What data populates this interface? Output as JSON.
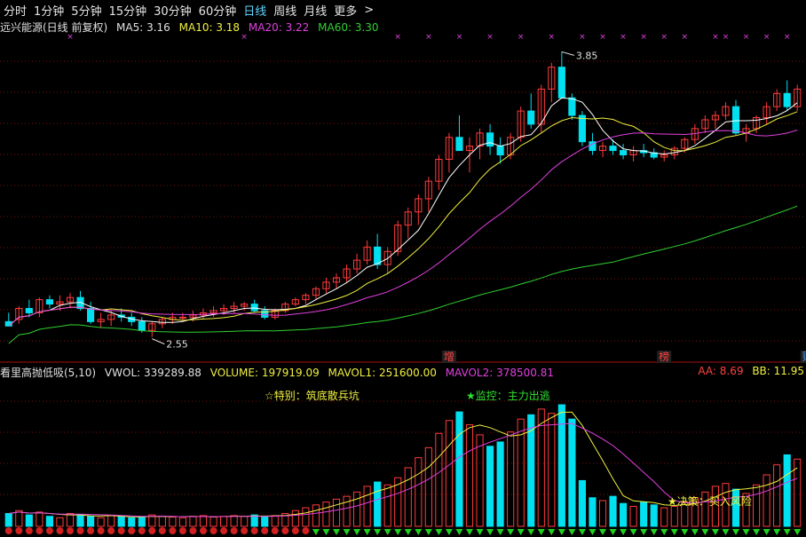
{
  "tabs": [
    {
      "label": "分时",
      "active": false
    },
    {
      "label": "1分钟",
      "active": false
    },
    {
      "label": "5分钟",
      "active": false
    },
    {
      "label": "15分钟",
      "active": false
    },
    {
      "label": "30分钟",
      "active": false
    },
    {
      "label": "60分钟",
      "active": false
    },
    {
      "label": "日线",
      "active": true
    },
    {
      "label": "周线",
      "active": false
    },
    {
      "label": "月线",
      "active": false
    },
    {
      "label": "更多",
      "active": false
    }
  ],
  "more_chevron": ">",
  "price_panel": {
    "title": "远兴能源(日线 前复权)",
    "ma5": "MA5: 3.16",
    "ma10": "MA10: 3.18",
    "ma20": "MA20: 3.22",
    "ma60": "MA60: 3.30",
    "high_label": "3.85",
    "low_label": "2.55",
    "event_tags": [
      "增",
      "榜",
      "财"
    ]
  },
  "volume_panel": {
    "title": "看里高抛低吸(5,10)",
    "vwol": "VWOL: 339289.88",
    "volume": "VOLUME: 197919.09",
    "mavol1": "MAVOL1: 251600.00",
    "mavol2": "MAVOL2: 378500.81",
    "aa": "AA: 8.69",
    "bb": "BB: 11.95",
    "note_special": "☆特别：筑底散兵坑",
    "note_monitor": "★监控：主力出逃",
    "note_decision": "★决策：买入风险"
  },
  "colors": {
    "up": "#ff3b3b",
    "down": "#00e0f0",
    "ma5": "#ffffff",
    "ma10": "#f0f040",
    "ma20": "#e040e0",
    "ma60": "#30d030",
    "grid": "#7a1010",
    "text_ma5": "#e0e0e0",
    "text_ma10": "#f0f040",
    "text_ma20": "#e040e0",
    "text_ma60": "#30d030",
    "annot": "#f0f040",
    "monitor": "#30e030",
    "aa": "#ff4040",
    "bb": "#f0f040",
    "volume": "#f0f040",
    "vwol": "#e0e0e0",
    "mavol1": "#f0f040",
    "mavol2": "#e040e0"
  },
  "chart_data": {
    "type": "candlestick",
    "price_range": [
      2.5,
      3.9
    ],
    "candles": [
      [
        2.62,
        2.66,
        2.6,
        2.6
      ],
      [
        2.63,
        2.69,
        2.61,
        2.68
      ],
      [
        2.68,
        2.72,
        2.64,
        2.66
      ],
      [
        2.66,
        2.73,
        2.64,
        2.72
      ],
      [
        2.72,
        2.74,
        2.68,
        2.7
      ],
      [
        2.7,
        2.74,
        2.67,
        2.71
      ],
      [
        2.71,
        2.75,
        2.68,
        2.73
      ],
      [
        2.73,
        2.76,
        2.67,
        2.68
      ],
      [
        2.68,
        2.71,
        2.61,
        2.62
      ],
      [
        2.62,
        2.66,
        2.59,
        2.63
      ],
      [
        2.63,
        2.67,
        2.6,
        2.65
      ],
      [
        2.65,
        2.68,
        2.62,
        2.64
      ],
      [
        2.64,
        2.66,
        2.6,
        2.62
      ],
      [
        2.62,
        2.64,
        2.57,
        2.58
      ],
      [
        2.58,
        2.62,
        2.55,
        2.61
      ],
      [
        2.61,
        2.64,
        2.59,
        2.63
      ],
      [
        2.63,
        2.66,
        2.61,
        2.64
      ],
      [
        2.64,
        2.66,
        2.62,
        2.64
      ],
      [
        2.64,
        2.67,
        2.62,
        2.65
      ],
      [
        2.65,
        2.68,
        2.63,
        2.66
      ],
      [
        2.66,
        2.69,
        2.64,
        2.67
      ],
      [
        2.67,
        2.7,
        2.65,
        2.68
      ],
      [
        2.68,
        2.71,
        2.66,
        2.69
      ],
      [
        2.69,
        2.71,
        2.67,
        2.7
      ],
      [
        2.7,
        2.72,
        2.66,
        2.67
      ],
      [
        2.67,
        2.69,
        2.63,
        2.64
      ],
      [
        2.64,
        2.68,
        2.63,
        2.67
      ],
      [
        2.67,
        2.71,
        2.66,
        2.7
      ],
      [
        2.7,
        2.73,
        2.69,
        2.72
      ],
      [
        2.72,
        2.75,
        2.7,
        2.74
      ],
      [
        2.74,
        2.78,
        2.72,
        2.77
      ],
      [
        2.77,
        2.82,
        2.75,
        2.8
      ],
      [
        2.8,
        2.84,
        2.77,
        2.82
      ],
      [
        2.82,
        2.88,
        2.8,
        2.86
      ],
      [
        2.86,
        2.93,
        2.84,
        2.9
      ],
      [
        2.9,
        2.99,
        2.88,
        2.96
      ],
      [
        2.96,
        3.02,
        2.86,
        2.88
      ],
      [
        2.88,
        2.96,
        2.84,
        2.94
      ],
      [
        2.94,
        3.08,
        2.92,
        3.06
      ],
      [
        3.06,
        3.14,
        3.0,
        3.12
      ],
      [
        3.12,
        3.2,
        3.06,
        3.18
      ],
      [
        3.18,
        3.28,
        3.12,
        3.26
      ],
      [
        3.26,
        3.38,
        3.22,
        3.36
      ],
      [
        3.36,
        3.48,
        3.3,
        3.46
      ],
      [
        3.46,
        3.56,
        3.42,
        3.4
      ],
      [
        3.4,
        3.46,
        3.3,
        3.42
      ],
      [
        3.42,
        3.5,
        3.36,
        3.48
      ],
      [
        3.48,
        3.52,
        3.38,
        3.42
      ],
      [
        3.42,
        3.46,
        3.34,
        3.38
      ],
      [
        3.38,
        3.48,
        3.36,
        3.46
      ],
      [
        3.46,
        3.6,
        3.44,
        3.58
      ],
      [
        3.58,
        3.66,
        3.5,
        3.52
      ],
      [
        3.52,
        3.7,
        3.48,
        3.68
      ],
      [
        3.68,
        3.8,
        3.62,
        3.78
      ],
      [
        3.78,
        3.85,
        3.7,
        3.64
      ],
      [
        3.64,
        3.66,
        3.54,
        3.56
      ],
      [
        3.56,
        3.58,
        3.42,
        3.44
      ],
      [
        3.44,
        3.48,
        3.38,
        3.4
      ],
      [
        3.4,
        3.44,
        3.37,
        3.42
      ],
      [
        3.42,
        3.45,
        3.38,
        3.4
      ],
      [
        3.4,
        3.43,
        3.36,
        3.38
      ],
      [
        3.38,
        3.42,
        3.35,
        3.4
      ],
      [
        3.4,
        3.43,
        3.37,
        3.39
      ],
      [
        3.39,
        3.41,
        3.36,
        3.37
      ],
      [
        3.37,
        3.4,
        3.35,
        3.38
      ],
      [
        3.38,
        3.42,
        3.36,
        3.41
      ],
      [
        3.41,
        3.46,
        3.39,
        3.45
      ],
      [
        3.45,
        3.52,
        3.43,
        3.5
      ],
      [
        3.5,
        3.56,
        3.48,
        3.54
      ],
      [
        3.54,
        3.58,
        3.5,
        3.56
      ],
      [
        3.56,
        3.62,
        3.54,
        3.6
      ],
      [
        3.6,
        3.63,
        3.47,
        3.48
      ],
      [
        3.48,
        3.52,
        3.44,
        3.5
      ],
      [
        3.5,
        3.56,
        3.48,
        3.55
      ],
      [
        3.55,
        3.62,
        3.52,
        3.6
      ],
      [
        3.6,
        3.68,
        3.58,
        3.66
      ],
      [
        3.66,
        3.72,
        3.58,
        3.6
      ],
      [
        3.6,
        3.7,
        3.58,
        3.68
      ]
    ],
    "volumes": [
      18,
      22,
      16,
      20,
      14,
      12,
      18,
      16,
      14,
      12,
      15,
      14,
      12,
      13,
      16,
      14,
      13,
      12,
      14,
      15,
      13,
      14,
      15,
      14,
      16,
      13,
      15,
      18,
      22,
      26,
      30,
      34,
      38,
      42,
      48,
      56,
      62,
      58,
      68,
      82,
      96,
      110,
      130,
      148,
      160,
      142,
      128,
      112,
      118,
      132,
      150,
      156,
      164,
      158,
      170,
      150,
      64,
      40,
      36,
      42,
      32,
      28,
      34,
      30,
      26,
      28,
      34,
      40,
      48,
      56,
      60,
      52,
      46,
      58,
      72,
      86,
      100,
      94
    ],
    "volume_max": 175
  }
}
